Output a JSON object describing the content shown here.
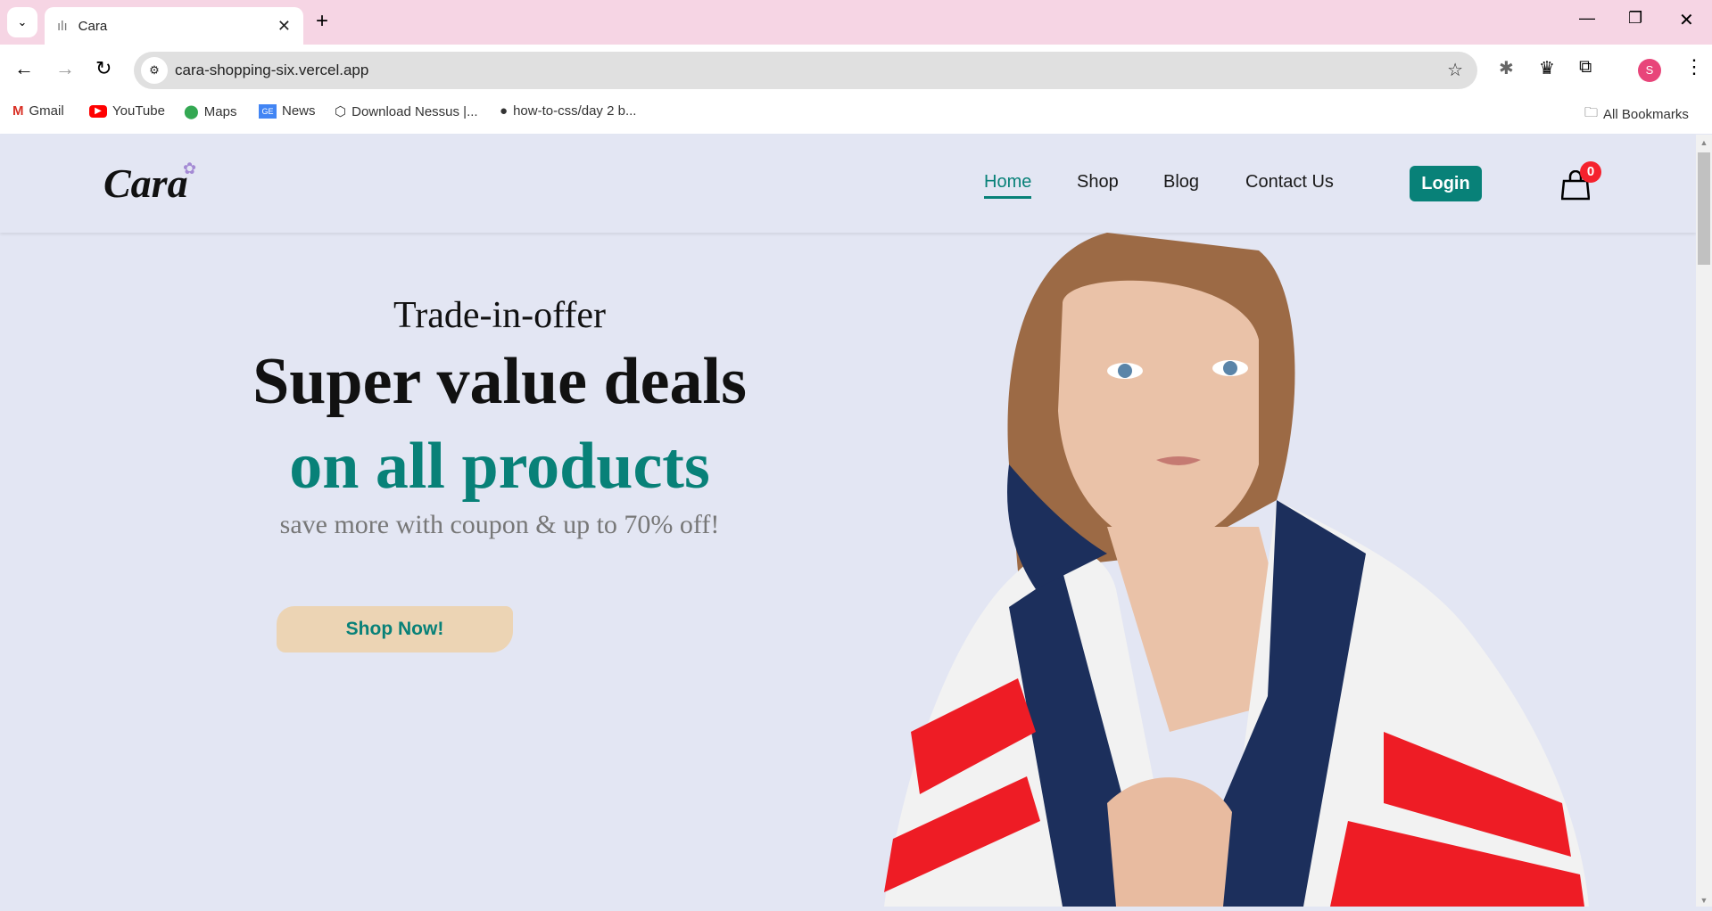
{
  "browser": {
    "tab_title": "Cara",
    "url": "cara-shopping-six.vercel.app",
    "profile_initial": "S",
    "bookmarks": [
      "Gmail",
      "YouTube",
      "Maps",
      "News",
      "Download Nessus |...",
      "how-to-css/day 2 b..."
    ],
    "all_bookmarks": "All Bookmarks"
  },
  "site": {
    "logo": "Cara",
    "nav": [
      "Home",
      "Shop",
      "Blog",
      "Contact Us"
    ],
    "login": "Login",
    "cart_count": "0",
    "hero": {
      "kicker": "Trade-in-offer",
      "headline": "Super value deals",
      "headline2": "on all products",
      "sub": "save more with coupon & up to 70% off!",
      "cta": "Shop Now!"
    },
    "colors": {
      "accent": "#088178",
      "badge": "#f5222d"
    }
  }
}
